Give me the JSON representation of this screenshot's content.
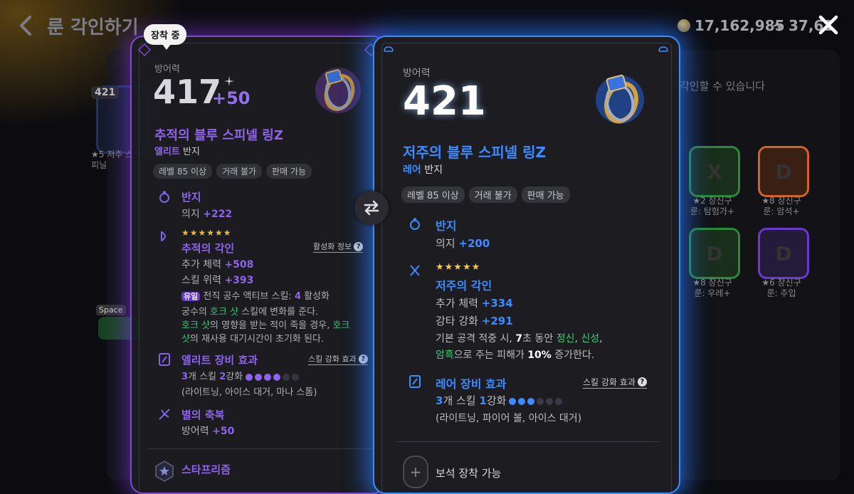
{
  "header": {
    "title": "룬 각인하기",
    "currency_gold": "17,162,985",
    "currency_other": "37,61"
  },
  "background": {
    "hint": "각인할 수 있습니다",
    "ghost_item_level": "421",
    "ghost_item_caption": "★5 저주 스피닐",
    "space_key": "Space",
    "runes": [
      {
        "caption1": "★2 장신구",
        "caption2": "룬: 탐험가+",
        "color": "#2a8a3a"
      },
      {
        "caption1": "★8 장신구",
        "caption2": "룬: 암석+",
        "color": "#d0622a"
      },
      {
        "caption1": "★8 장신구",
        "caption2": "룬: 우레+",
        "color": "#2a8a3a"
      },
      {
        "caption1": "★6 장신구",
        "caption2": "룬: 주입",
        "color": "#6a3ad0"
      }
    ]
  },
  "equipped": {
    "tooltip": "장착 중",
    "stat_label": "방어력",
    "stat_value": "417",
    "stat_bonus": "+50",
    "name": "추적의 블루 스피넬 링Z",
    "grade": "엘리트",
    "type": "반지",
    "tags": [
      "레벨 85 이상",
      "거래 불가",
      "판매 가능"
    ],
    "slot_title": "반지",
    "slot_stat_label": "의지",
    "slot_stat_value": "+222",
    "rune_stars": "★★★★★★",
    "rune_title": "추적의 각인",
    "activation_info": "활성화 정보",
    "rune_stat1_label": "추가 체력",
    "rune_stat1_value": "+508",
    "rune_stat2_label": "스킬 위력",
    "rune_stat2_value": "+393",
    "unique_badge": "유일",
    "unique_text_pre": "전직 공수 액티브 스킬:",
    "unique_count": "4",
    "unique_text_post": "활성화",
    "desc1_pre": "궁수의 ",
    "desc1_hl": "호크 샷",
    "desc1_post": " 스킬에 변화를 준다.",
    "desc2_hl": "호크 샷",
    "desc2_mid": "의 영향을 받는 적이 죽을 경우, ",
    "desc2_hl2": "호크",
    "desc3_hl": "샷",
    "desc3_post": "의 재사용 대기시간이 초기화 된다.",
    "set_title": "엘리트 장비 효과",
    "set_link": "스킬 강화 효과",
    "set_count": "3",
    "set_text_mid": "개 스킬",
    "set_level": "2",
    "set_text_post": "강화",
    "set_dots_filled": 4,
    "set_dots_total": 6,
    "set_skills": "(라이트닝, 아이스 대거, 마나 스톰)",
    "blessing_title": "별의 축복",
    "blessing_label": "방어력",
    "blessing_value": "+50",
    "star_prism_title": "스타프리즘",
    "colors": {
      "accent": "#9a6cff",
      "border": "#8a4fe0"
    }
  },
  "compare": {
    "stat_label": "방어력",
    "stat_value": "421",
    "name": "저주의 블루 스피넬 링Z",
    "grade": "레어",
    "type": "반지",
    "tags": [
      "레벨 85 이상",
      "거래 불가",
      "판매 가능"
    ],
    "slot_title": "반지",
    "slot_stat_label": "의지",
    "slot_stat_value": "+200",
    "rune_stars": "★★★★★",
    "rune_title": "저주의 각인",
    "rune_stat1_label": "추가 체력",
    "rune_stat1_value": "+334",
    "rune_stat2_label": "강타 강화",
    "rune_stat2_value": "+291",
    "desc1_pre": "기본 공격 적중 시, ",
    "desc1_num": "7",
    "desc1_mid": "초 동안 ",
    "desc1_hl1": "정신",
    "desc1_sep1": ", ",
    "desc1_hl2": "신성",
    "desc1_sep2": ",",
    "desc2_hl": "암흑",
    "desc2_mid": "으로 주는 피해가 ",
    "desc2_num": "10%",
    "desc2_post": " 증가한다.",
    "set_title": "레어 장비 효과",
    "set_link": "스킬 강화 효과",
    "set_count": "3",
    "set_text_mid": "개 스킬",
    "set_level": "1",
    "set_text_post": "강화",
    "set_dots_filled": 3,
    "set_dots_total": 6,
    "set_skills": "(라이트닝, 파이어 볼, 아이스 대거)",
    "socket_text": "보석 장착 가능",
    "colors": {
      "accent": "#3c8bff",
      "border": "#3b8cff"
    }
  }
}
